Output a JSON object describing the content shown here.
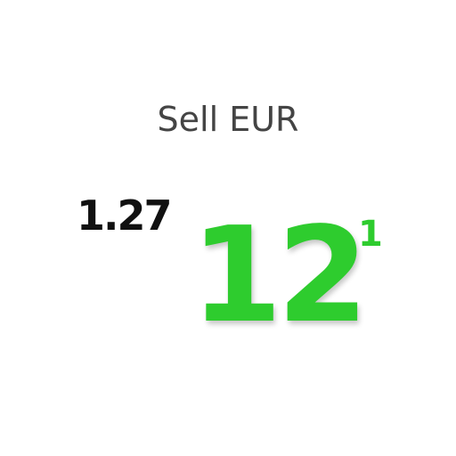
{
  "quote": {
    "label": "Sell EUR",
    "big_figure": "1.27",
    "pips": "12",
    "fractional_pip": "1",
    "accent_color": "#2ecc2e"
  }
}
